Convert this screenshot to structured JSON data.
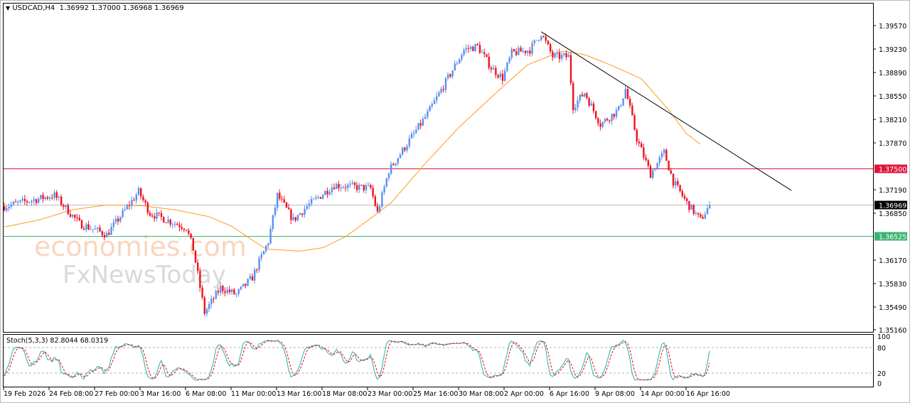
{
  "header": {
    "symbol": "USDCAD,H4",
    "open": "1.36992",
    "high": "1.37000",
    "low": "1.36968",
    "close": "1.36969"
  },
  "watermark": {
    "line1": "economies.com",
    "line2": "FxNewsToday"
  },
  "colors": {
    "bull": "#5b8ff0",
    "bear": "#f0101e",
    "ma": "#ff9a1f",
    "resistance": "#e0143c",
    "support": "#3cb371",
    "stoch_main": "#20b2aa",
    "stoch_signal": "#ff0000"
  },
  "chart_data": {
    "type": "candlestick",
    "title": "USDCAD,H4",
    "ylim": [
      1.3502,
      1.3995
    ],
    "y_ticks": [
      "1.39570",
      "1.39230",
      "1.38890",
      "1.38550",
      "1.38210",
      "1.37870",
      "1.37190",
      "1.36850",
      "1.36170",
      "1.35830",
      "1.35490",
      "1.35160"
    ],
    "x_ticks": [
      {
        "bar": 0,
        "label": "19 Feb 2026"
      },
      {
        "bar": 20,
        "label": "24 Feb 08:00"
      },
      {
        "bar": 40,
        "label": "27 Feb 00:00"
      },
      {
        "bar": 60,
        "label": "3 Mar 16:00"
      },
      {
        "bar": 80,
        "label": "6 Mar 08:00"
      },
      {
        "bar": 100,
        "label": "11 Mar 00:00"
      },
      {
        "bar": 120,
        "label": "13 Mar 16:00"
      },
      {
        "bar": 140,
        "label": "18 Mar 08:00"
      },
      {
        "bar": 160,
        "label": "23 Mar 00:00"
      },
      {
        "bar": 180,
        "label": "25 Mar 16:00"
      },
      {
        "bar": 200,
        "label": "30 Mar 08:00"
      },
      {
        "bar": 220,
        "label": "2 Apr 00:00"
      },
      {
        "bar": 240,
        "label": "6 Apr 16:00"
      },
      {
        "bar": 260,
        "label": "9 Apr 08:00"
      },
      {
        "bar": 280,
        "label": "14 Apr 00:00"
      },
      {
        "bar": 300,
        "label": "16 Apr 16:00"
      }
    ],
    "close_path": [
      [
        0,
        1.3695
      ],
      [
        22,
        1.3711
      ],
      [
        33,
        1.367
      ],
      [
        45,
        1.3654
      ],
      [
        59,
        1.3716
      ],
      [
        64,
        1.3685
      ],
      [
        80,
        1.3664
      ],
      [
        83,
        1.3633
      ],
      [
        88,
        1.3541
      ],
      [
        95,
        1.3577
      ],
      [
        102,
        1.3567
      ],
      [
        109,
        1.3592
      ],
      [
        116,
        1.3644
      ],
      [
        120,
        1.3711
      ],
      [
        127,
        1.3675
      ],
      [
        133,
        1.3695
      ],
      [
        145,
        1.3726
      ],
      [
        161,
        1.3721
      ],
      [
        164,
        1.3685
      ],
      [
        169,
        1.3747
      ],
      [
        186,
        1.3829
      ],
      [
        195,
        1.3881
      ],
      [
        202,
        1.3922
      ],
      [
        208,
        1.3927
      ],
      [
        214,
        1.3896
      ],
      [
        219,
        1.3881
      ],
      [
        223,
        1.3917
      ],
      [
        231,
        1.3922
      ],
      [
        236,
        1.3946
      ],
      [
        241,
        1.3912
      ],
      [
        248,
        1.3912
      ],
      [
        250,
        1.384
      ],
      [
        255,
        1.386
      ],
      [
        262,
        1.3814
      ],
      [
        270,
        1.3835
      ],
      [
        273,
        1.3865
      ],
      [
        278,
        1.3793
      ],
      [
        284,
        1.3742
      ],
      [
        290,
        1.3773
      ],
      [
        294,
        1.3731
      ],
      [
        300,
        1.37
      ],
      [
        306,
        1.3675
      ],
      [
        310,
        1.3697
      ]
    ],
    "moving_average": [
      [
        0,
        1.3665
      ],
      [
        15,
        1.3675
      ],
      [
        30,
        1.369
      ],
      [
        45,
        1.3697
      ],
      [
        60,
        1.3696
      ],
      [
        75,
        1.369
      ],
      [
        90,
        1.368
      ],
      [
        100,
        1.3666
      ],
      [
        115,
        1.3633
      ],
      [
        130,
        1.363
      ],
      [
        140,
        1.3635
      ],
      [
        150,
        1.3651
      ],
      [
        160,
        1.3675
      ],
      [
        170,
        1.37
      ],
      [
        185,
        1.3757
      ],
      [
        200,
        1.381
      ],
      [
        218,
        1.3865
      ],
      [
        230,
        1.39
      ],
      [
        245,
        1.392
      ],
      [
        255,
        1.3915
      ],
      [
        265,
        1.3902
      ],
      [
        280,
        1.388
      ],
      [
        292,
        1.3835
      ],
      [
        300,
        1.38
      ],
      [
        306,
        1.3785
      ]
    ],
    "trendline": [
      [
        236,
        1.3948
      ],
      [
        346,
        1.3718
      ]
    ],
    "levels": [
      {
        "name": "resistance",
        "price": 1.375,
        "label": "1.37500"
      },
      {
        "name": "current-price",
        "price": 1.36969,
        "label": "1.36969"
      },
      {
        "name": "support",
        "price": 1.36525,
        "label": "1.36525"
      }
    ],
    "stochastic": {
      "label": "Stoch(5,3,3) 82.8044 68.0319",
      "k": 5,
      "d": 3,
      "slowing": 3,
      "levels": [
        {
          "v": 100,
          "label": "100"
        },
        {
          "v": 80,
          "label": "80"
        },
        {
          "v": 20,
          "label": "20"
        },
        {
          "v": 0,
          "label": "0"
        }
      ]
    }
  }
}
